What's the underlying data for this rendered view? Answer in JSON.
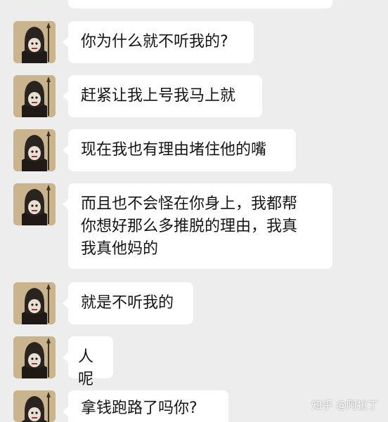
{
  "messages": [
    {
      "text": ""
    },
    {
      "text": "你为什么就不听我的?"
    },
    {
      "text": "赶紧让我上号我马上就"
    },
    {
      "text": "现在我也有理由堵住他的嘴"
    },
    {
      "text": "而且也不会怪在你身上，我都帮\n你想好那么多推脱的理由，我真\n我真他妈的"
    },
    {
      "text": "就是不听我的"
    },
    {
      "text": "人呢"
    },
    {
      "text": "拿钱跑路了吗你?"
    }
  ],
  "watermark": "知乎 @阿拉丁",
  "colors": {
    "background": "#ededed",
    "bubble": "#ffffff",
    "text": "#151515"
  }
}
